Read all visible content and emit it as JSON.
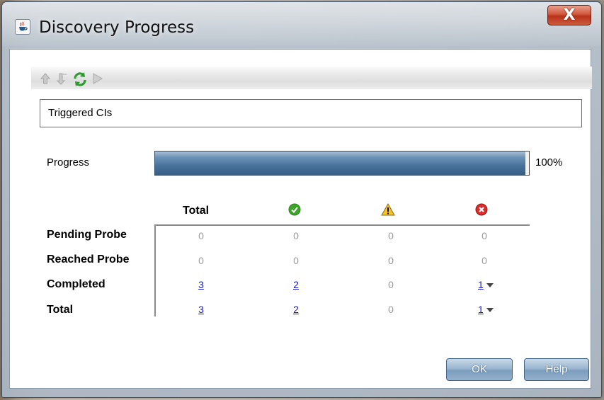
{
  "window": {
    "title": "Discovery Progress",
    "close_label": "X"
  },
  "toolbar": {
    "icons": [
      "arrow-up-icon",
      "arrow-down-icon",
      "refresh-icon",
      "next-icon"
    ]
  },
  "triggered_cis": {
    "label": "Triggered CIs"
  },
  "progress": {
    "label": "Progress",
    "value": 0.99,
    "value_text": "100%"
  },
  "table": {
    "columns": [
      "Total",
      "success-icon",
      "warning-icon",
      "error-icon"
    ],
    "rows": [
      {
        "label": "Pending Probe",
        "total": "0",
        "success": "0",
        "warning": "0",
        "error": "0"
      },
      {
        "label": "Reached Probe",
        "total": "0",
        "success": "0",
        "warning": "0",
        "error": "0"
      },
      {
        "label": "Completed",
        "total": "3",
        "success": "2",
        "warning": "0",
        "error": "1"
      },
      {
        "label": "Total",
        "total": "3",
        "success": "2",
        "warning": "0",
        "error": "1"
      }
    ]
  },
  "buttons": {
    "ok": "OK",
    "help": "Help"
  },
  "colors": {
    "link": "#1a1acc",
    "progress": "#4a739c",
    "success": "#3da52a",
    "warning": "#f2b41c",
    "error": "#d92b2b"
  }
}
